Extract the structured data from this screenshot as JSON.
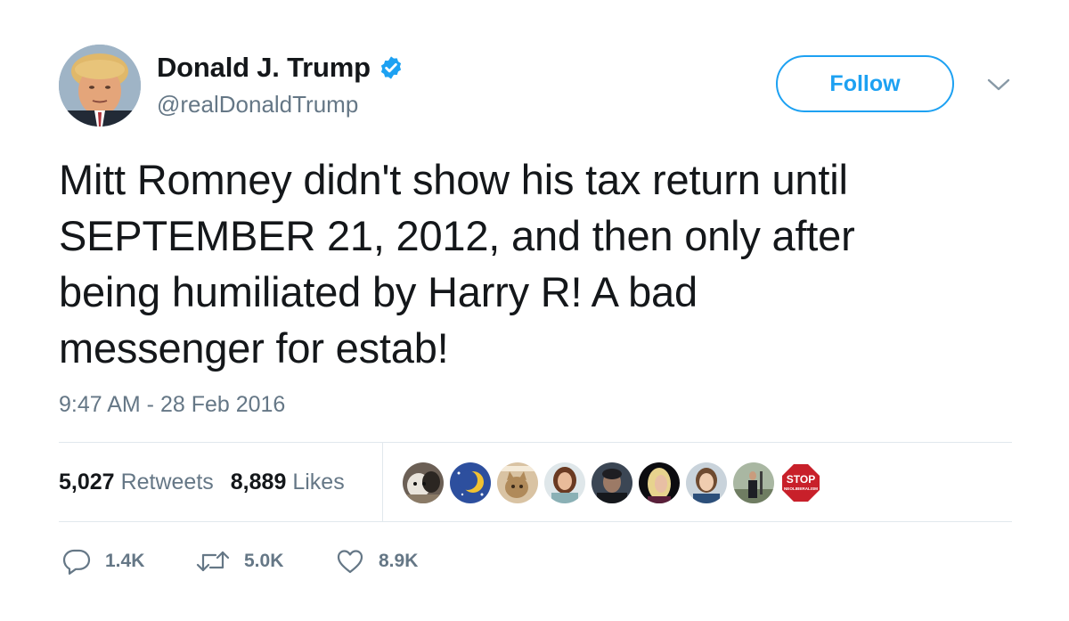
{
  "author": {
    "display_name": "Donald J. Trump",
    "handle": "@realDonaldTrump",
    "verified": true
  },
  "follow_button": {
    "label": "Follow"
  },
  "tweet": {
    "text": "Mitt Romney didn't show his tax return until\nSEPTEMBER 21, 2012, and then only after\nbeing humiliated by Harry R! A bad\nmessenger for estab!",
    "timestamp": "9:47 AM - 28 Feb 2016"
  },
  "stats": {
    "retweets": {
      "count": "5,027",
      "label": "Retweets"
    },
    "likes": {
      "count": "8,889",
      "label": "Likes"
    }
  },
  "likers": [
    {
      "icon": "liker-avatar-dog"
    },
    {
      "icon": "liker-avatar-sun-moon"
    },
    {
      "icon": "liker-avatar-cat"
    },
    {
      "icon": "liker-avatar-woman-brunette"
    },
    {
      "icon": "liker-avatar-man-dark"
    },
    {
      "icon": "liker-avatar-woman-blonde"
    },
    {
      "icon": "liker-avatar-woman-portrait"
    },
    {
      "icon": "liker-avatar-man-outdoors"
    },
    {
      "icon": "liker-avatar-stop-sign",
      "text_top": "STOP",
      "text_bottom": "NEOLIBERALISM"
    }
  ],
  "actions": {
    "reply": {
      "count": "1.4K",
      "icon": "reply-icon"
    },
    "retweet": {
      "count": "5.0K",
      "icon": "retweet-icon"
    },
    "like": {
      "count": "8.9K",
      "icon": "heart-icon"
    }
  },
  "colors": {
    "accent": "#1da1f2",
    "secondary_text": "#657786",
    "primary_text": "#14171a",
    "divider": "#e1e8ed"
  }
}
